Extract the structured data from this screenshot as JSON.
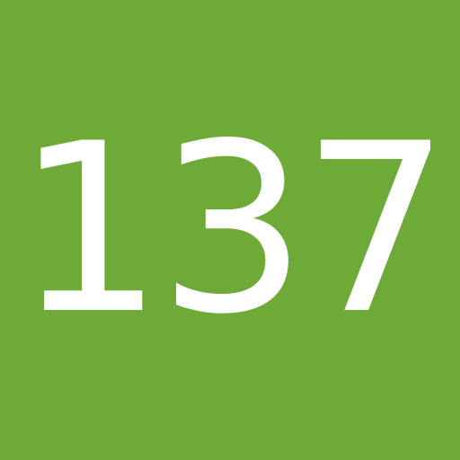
{
  "tile": {
    "number": "137",
    "background_color": "#6eaa37",
    "text_color": "#ffffff"
  }
}
